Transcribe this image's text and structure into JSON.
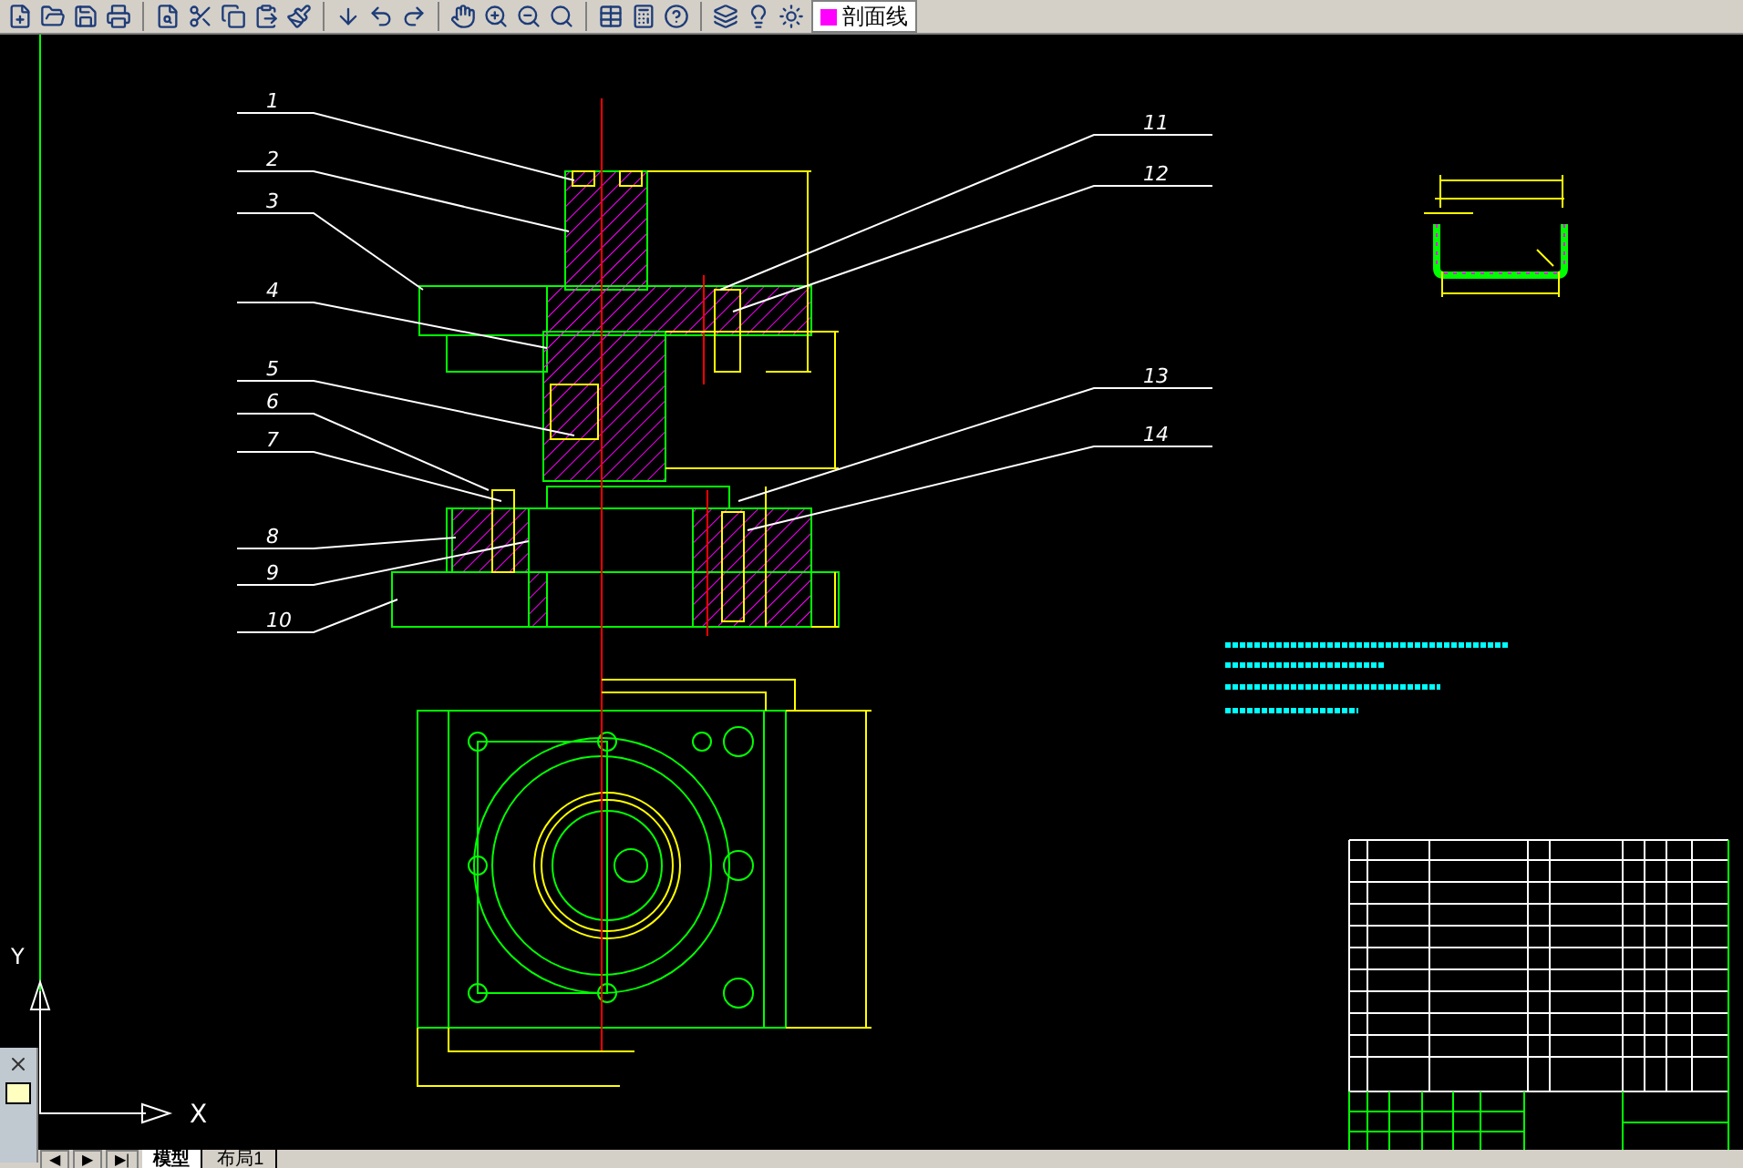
{
  "toolbar": {
    "layer_name": "剖面线"
  },
  "left_labels": [
    "1",
    "2",
    "3",
    "4",
    "5",
    "6",
    "7",
    "8",
    "9",
    "10"
  ],
  "right_labels": [
    "11",
    "12",
    "13",
    "14"
  ],
  "ucs": {
    "x_label": "X",
    "y_label": "Y"
  },
  "nav_buttons": [
    "◀",
    "▶",
    "▶|"
  ],
  "tabs": [
    {
      "label": "模型",
      "selected": true
    },
    {
      "label": "布局1",
      "selected": false
    }
  ]
}
